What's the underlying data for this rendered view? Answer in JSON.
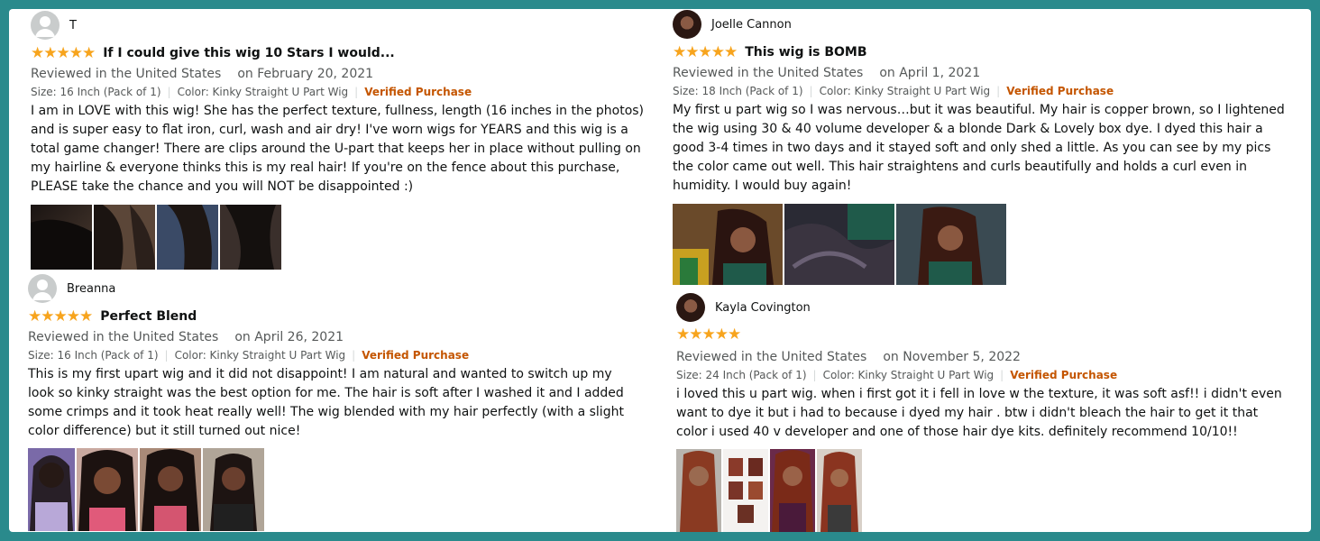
{
  "reviews": [
    {
      "username": "T",
      "avatar": "generic-user-icon",
      "rating": 5,
      "stars": "★★★★★",
      "title": "If I could give this wig 10 Stars I would...",
      "reviewed_in": "Reviewed in the United States",
      "date": "on February 20, 2021",
      "size": "Size: 16 Inch (Pack of 1)",
      "color": "Color: Kinky Straight U Part Wig",
      "verified": "Verified Purchase",
      "body": "I am in LOVE with this wig! She has the perfect texture, fullness, length (16 inches in the photos) and is super easy to flat iron, curl, wash and air dry! I've worn wigs for YEARS and this wig is a total game changer! There are clips around the U-part that keeps her in place without pulling on my hairline & everyone thinks this is my real hair! If you're on the fence about this purchase, PLEASE take the chance and you will NOT be disappointed :)"
    },
    {
      "username": "Breanna",
      "avatar": "generic-user-icon",
      "rating": 5,
      "stars": "★★★★★",
      "title": "Perfect Blend",
      "reviewed_in": "Reviewed in the United States",
      "date": "on April 26, 2021",
      "size": "Size: 16 Inch (Pack of 1)",
      "color": "Color: Kinky Straight U Part Wig",
      "verified": "Verified Purchase",
      "body": "This is my first upart wig and it did not disappoint! I am natural and wanted to switch up my look so kinky straight was the best option for me. The hair is soft after I washed it and I added some crimps and it took heat really well! The wig blended with my hair perfectly (with a slight color difference) but it still turned out nice!"
    },
    {
      "username": "Joelle Cannon",
      "avatar": "profile-photo",
      "rating": 5,
      "stars": "★★★★★",
      "title": "This wig is BOMB",
      "reviewed_in": "Reviewed in the United States",
      "date": "on April 1, 2021",
      "size": "Size: 18 Inch (Pack of 1)",
      "color": "Color: Kinky Straight U Part Wig",
      "verified": "Verified Purchase",
      "body": "My first u part wig so I was nervous…but it was beautiful. My hair is copper brown, so I lightened the wig using 30 & 40 volume developer & a blonde Dark & Lovely box dye. I dyed this hair a good 3-4 times in two days and it stayed soft and only shed a little. As you can see by my pics the color came out well. This hair straightens and curls beautifully and holds a curl even in humidity. I would buy again!"
    },
    {
      "username": "Kayla Covington",
      "avatar": "profile-photo",
      "rating": 5,
      "stars": "★★★★★",
      "title": "",
      "reviewed_in": "Reviewed in the United States",
      "date": "on November 5, 2022",
      "size": "Size: 24 Inch (Pack of 1)",
      "color": "Color: Kinky Straight U Part Wig",
      "verified": "Verified Purchase",
      "body": "i loved this u part wig. when i first got it i fell in love w the texture, it was soft asf!! i didn't even want to dye it but i had to because i dyed my hair  . btw i didn't bleach the hair to get it that color i used 40 v developer and one of those hair dye kits. definitely recommend 10/10!!"
    }
  ],
  "colors": {
    "background": "#2a8a8c",
    "star": "#f7a41d",
    "verified": "#c45500",
    "meta_text": "#565959"
  }
}
